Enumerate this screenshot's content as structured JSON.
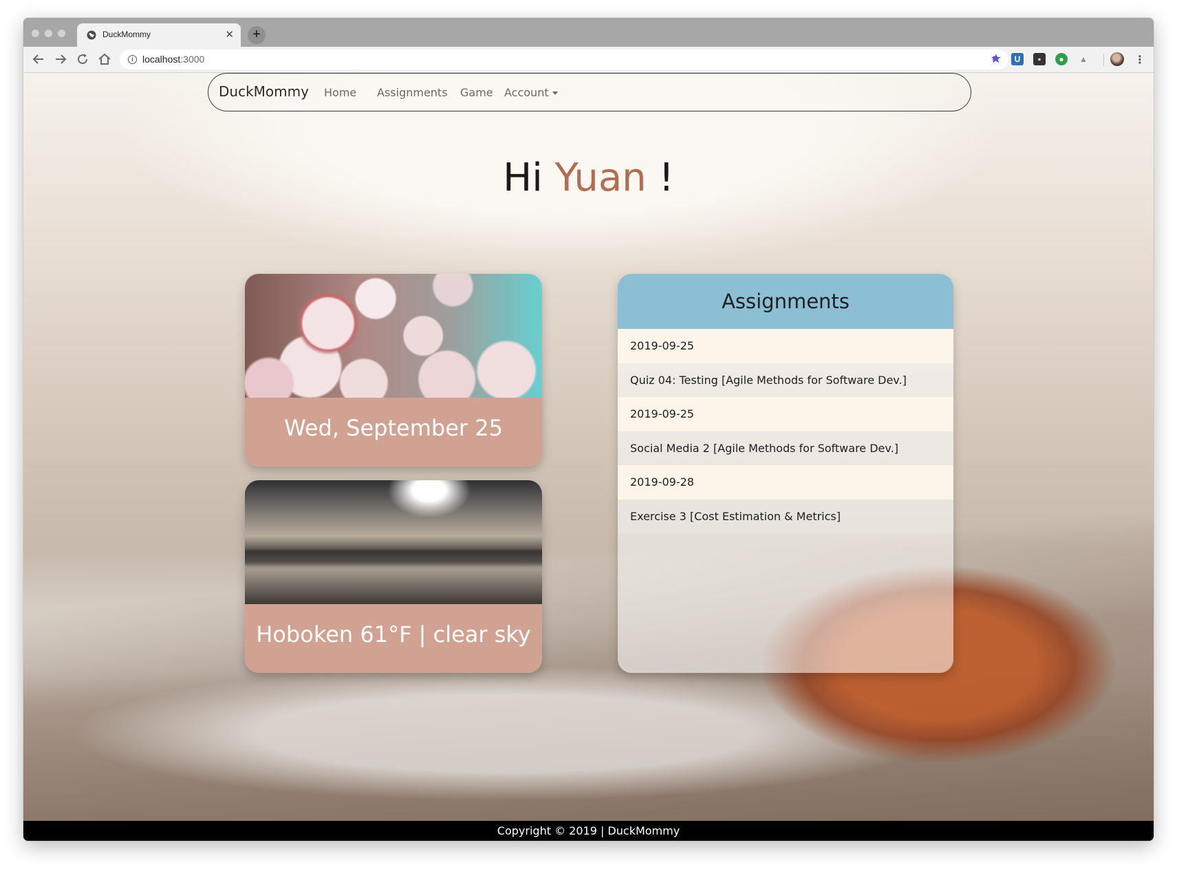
{
  "browser": {
    "tab_title": "DuckMommy",
    "close_glyph": "✕",
    "new_tab_glyph": "+",
    "url_host": "localhost",
    "url_port": ":3000"
  },
  "navbar": {
    "brand": "DuckMommy",
    "links": [
      "Home",
      "Assignments",
      "Game"
    ],
    "account_label": "Account"
  },
  "greeting": {
    "prefix": "Hi",
    "name": "Yuan",
    "suffix": "!"
  },
  "cards": {
    "date": "Wed, September 25",
    "weather": "Hoboken 61°F | clear sky"
  },
  "assignments": {
    "title": "Assignments",
    "items": [
      {
        "due": "2019-09-25",
        "name": "Quiz 04: Testing [Agile Methods for Software Dev.]"
      },
      {
        "due": "2019-09-25",
        "name": "Social Media 2 [Agile Methods for Software Dev.]"
      },
      {
        "due": "2019-09-28",
        "name": "Exercise 3 [Cost Estimation & Metrics]"
      }
    ]
  },
  "footer": {
    "text": "Copyright © 2019 | DuckMommy"
  },
  "colors": {
    "accent_name": "#b36d50",
    "card_caption_bg": "#d1a192",
    "assignments_header_bg": "#8cbfd4"
  },
  "icons": [
    "globe-icon",
    "back-arrow-icon",
    "forward-arrow-icon",
    "reload-icon",
    "home-icon",
    "info-icon",
    "star-icon",
    "avatar",
    "kebab-menu-icon"
  ]
}
